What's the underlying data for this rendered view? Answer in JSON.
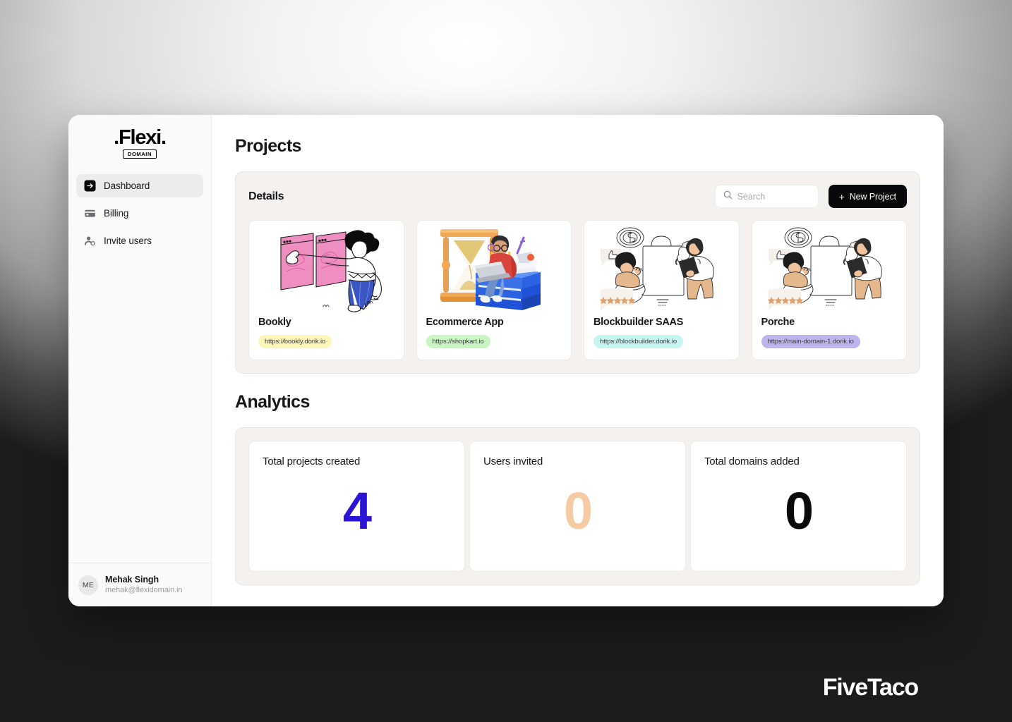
{
  "sidebar": {
    "logo": {
      "name": "Flexi",
      "dot_left": ".",
      "dot_right": ".",
      "sub": "DOMAIN"
    },
    "items": [
      {
        "label": "Dashboard",
        "icon": "arrow-right-box-icon",
        "active": true
      },
      {
        "label": "Billing",
        "icon": "credit-card-icon",
        "active": false
      },
      {
        "label": "Invite users",
        "icon": "user-plus-icon",
        "active": false
      }
    ],
    "profile": {
      "initials": "ME",
      "name": "Mehak Singh",
      "email": "mehak@flexidomain.in"
    }
  },
  "main": {
    "page_title": "Projects",
    "details": {
      "title": "Details",
      "search": {
        "value": "",
        "placeholder": "Search"
      },
      "new_project_label": "New Project",
      "new_project_plus": "+",
      "projects": [
        {
          "name": "Bookly",
          "url": "https://bookly.dorik.io",
          "badge_bg": "#fbf5b7",
          "art": "woman-pointing-browser-windows"
        },
        {
          "name": "Ecommerce App",
          "url": "https://shopkart.io",
          "badge_bg": "#c9f5c3",
          "art": "hourglass-books-laptop"
        },
        {
          "name": "Blockbuilder SAAS",
          "url": "https://blockbuilder.dorik.io",
          "badge_bg": "#c6f5f2",
          "art": "marketing-megaphone-shopping"
        },
        {
          "name": "Porche",
          "url": "https://main-domain-1.dorik.io",
          "badge_bg": "#bdb6ee",
          "art": "marketing-megaphone-shopping"
        }
      ]
    },
    "analytics": {
      "title": "Analytics",
      "stats": [
        {
          "label": "Total projects created",
          "value": "4",
          "color": "#2b14d4"
        },
        {
          "label": "Users invited",
          "value": "0",
          "color": "#f6cba4"
        },
        {
          "label": "Total domains added",
          "value": "0",
          "color": "#0b0b0d"
        }
      ]
    }
  },
  "watermark": {
    "text": "FiveTaco"
  },
  "colors": {
    "accent_black": "#09090b",
    "panel_bg": "#f4f1ee",
    "sidebar_bg": "#fafafa"
  }
}
